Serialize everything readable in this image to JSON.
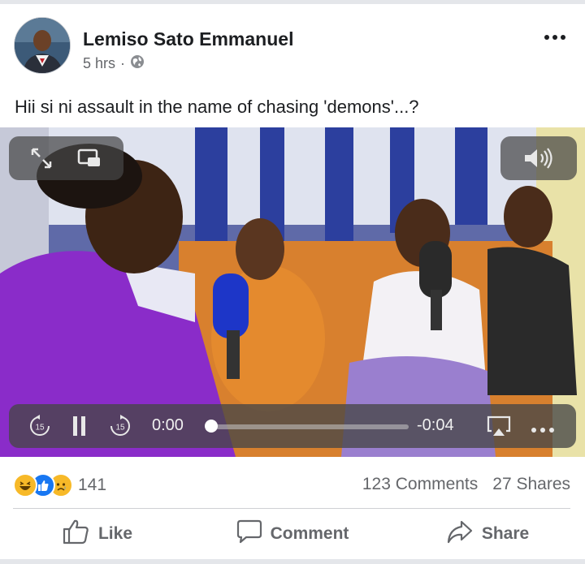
{
  "post": {
    "author": "Lemiso Sato Emmanuel",
    "time": "5 hrs",
    "separator": "·",
    "privacy_icon": "globe-icon",
    "text": "Hii si ni assault in the name of chasing 'demons'...?"
  },
  "video": {
    "elapsed": "0:00",
    "remaining": "-0:04",
    "skip_back_label": "15",
    "skip_forward_label": "15",
    "progress_fraction": 0.0
  },
  "stats": {
    "reaction_count": "141",
    "comments": "123 Comments",
    "shares": "27 Shares",
    "reaction_icons": [
      "haha-icon",
      "like-icon",
      "sad-icon"
    ]
  },
  "actions": {
    "like": "Like",
    "comment": "Comment",
    "share": "Share"
  },
  "colors": {
    "text": "#1c1e21",
    "secondary": "#65676b",
    "like_blue": "#1877f2",
    "reaction_yellow": "#f7b928"
  }
}
